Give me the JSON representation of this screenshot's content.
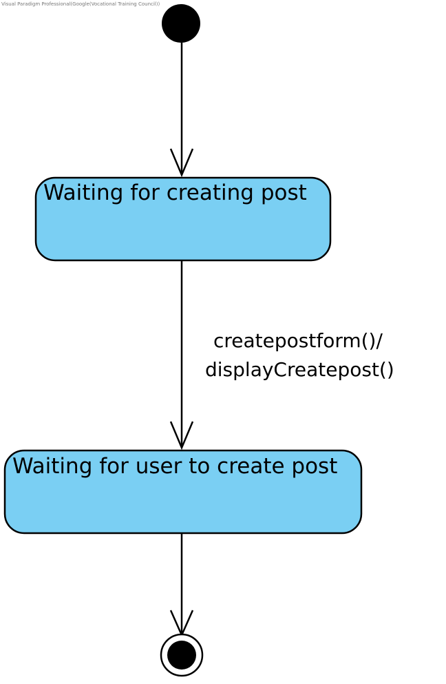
{
  "watermark": "Visual Paradigm Professional(Google(Vocational Training Council))",
  "states": [
    {
      "name": "Waiting for creating post"
    },
    {
      "name": "Waiting for user to create post"
    }
  ],
  "transitions": [
    {
      "from": "initial",
      "to": "Waiting for creating post",
      "label": ""
    },
    {
      "from": "Waiting for creating post",
      "to": "Waiting for user to create post",
      "label_line1": "createpostform()/",
      "label_line2": "displayCreatepost()"
    },
    {
      "from": "Waiting for user to create post",
      "to": "final",
      "label": ""
    }
  ],
  "colors": {
    "state_fill": "#7acff3",
    "stroke": "#000000",
    "background": "#ffffff"
  }
}
